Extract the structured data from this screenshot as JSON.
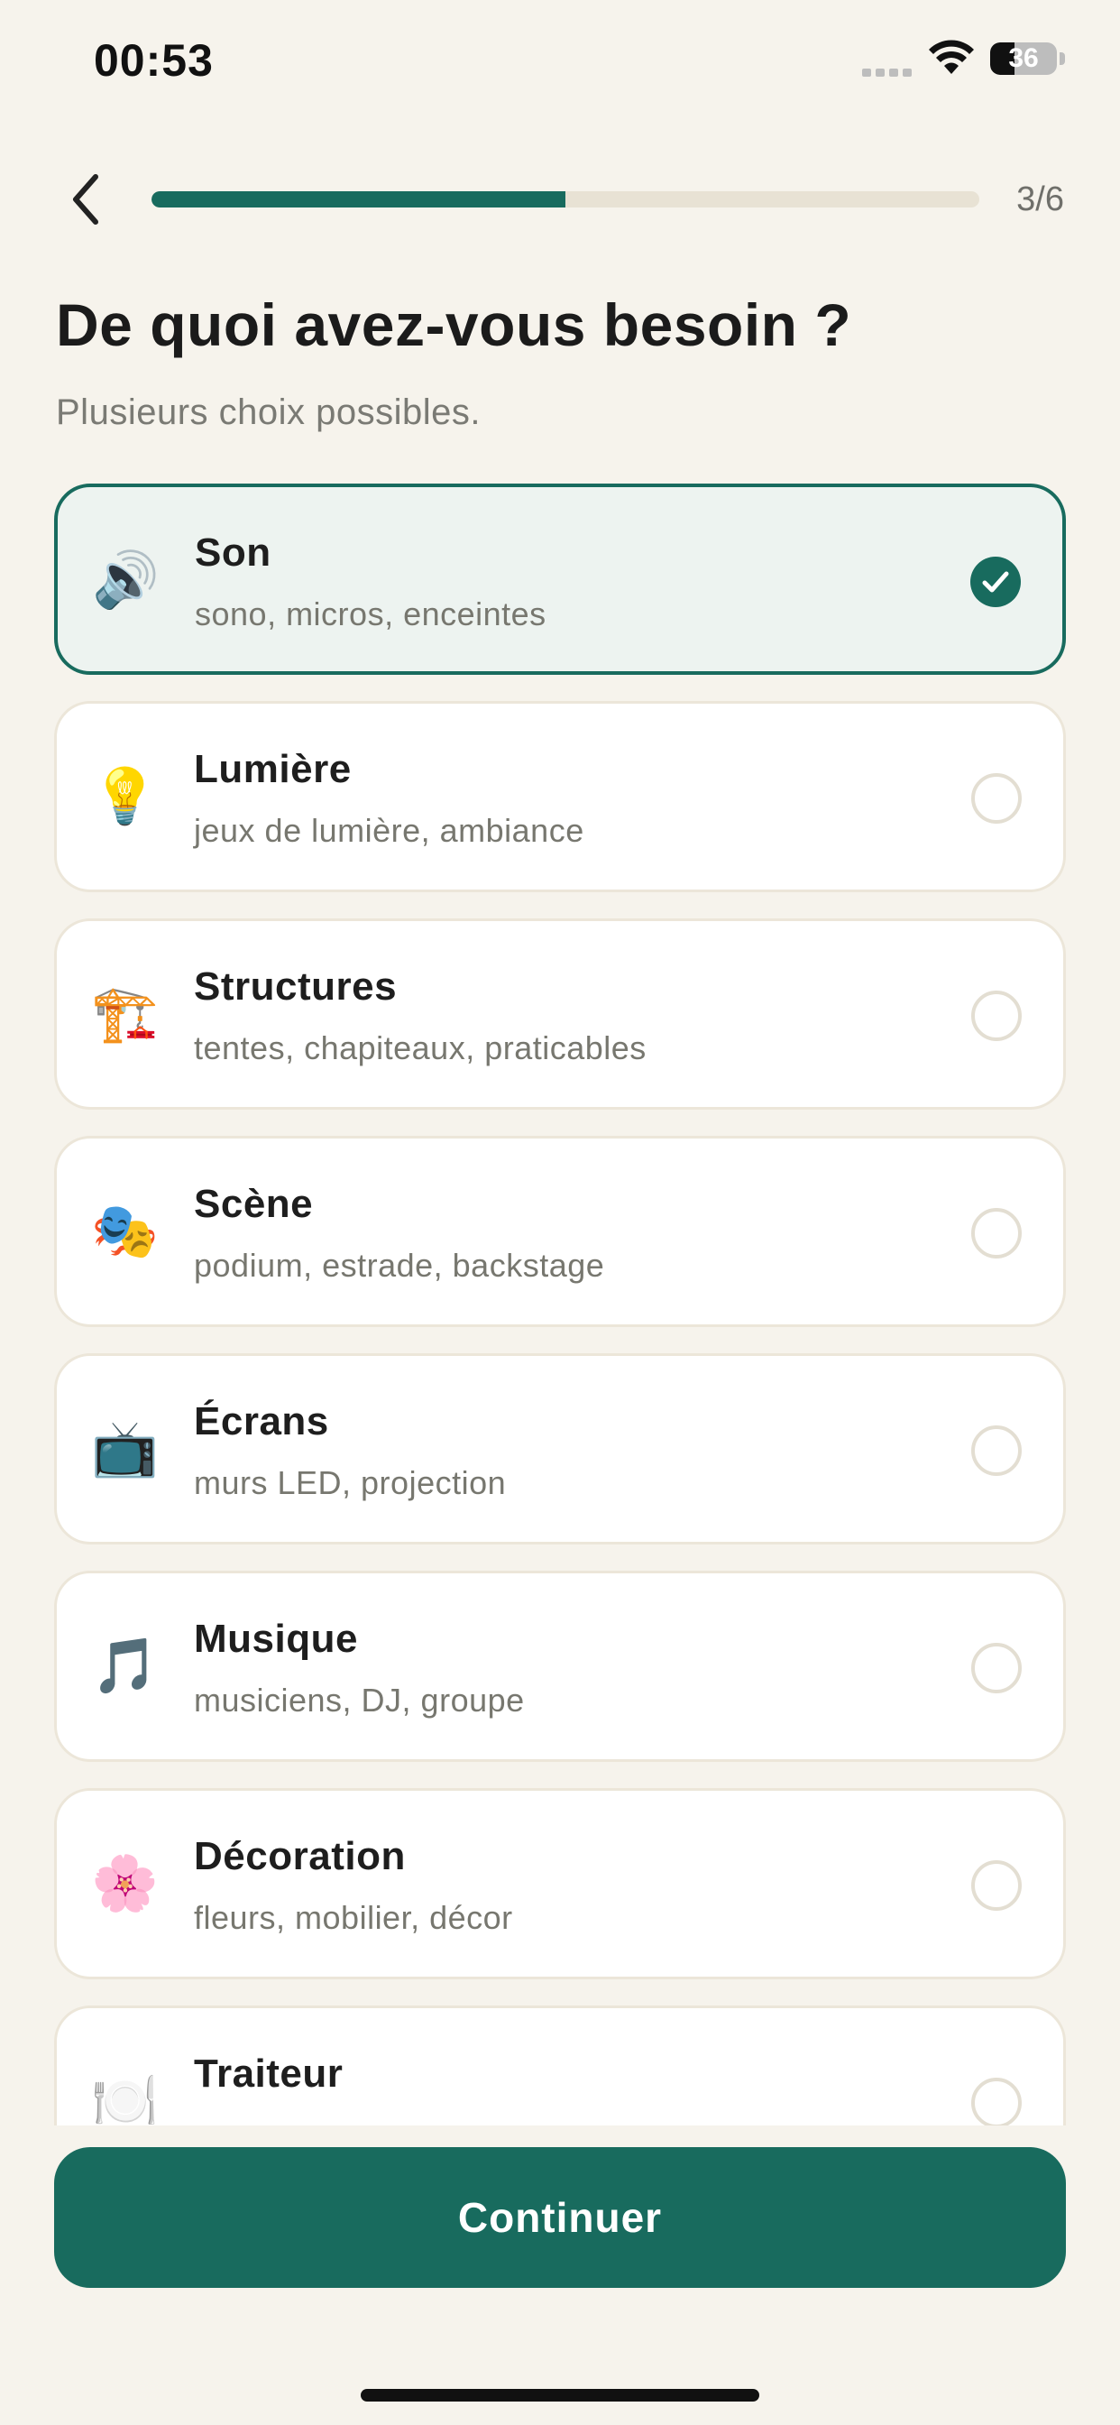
{
  "status_bar": {
    "time": "00:53",
    "battery": "36",
    "battery_level": 0.36
  },
  "header": {
    "step_counter": "3/6",
    "progress": 0.5
  },
  "title": "De quoi avez-vous besoin ?",
  "subtitle": "Plusieurs choix possibles.",
  "options": [
    {
      "emoji": "🔊",
      "icon": "speaker-icon",
      "title": "Son",
      "desc": "sono, micros, enceintes",
      "selected": true
    },
    {
      "emoji": "💡",
      "icon": "light-bulb-icon",
      "title": "Lumière",
      "desc": "jeux de lumière, ambiance",
      "selected": false
    },
    {
      "emoji": "🏗️",
      "icon": "crane-icon",
      "title": "Structures",
      "desc": "tentes, chapiteaux, praticables",
      "selected": false
    },
    {
      "emoji": "🎭",
      "icon": "theater-masks-icon",
      "title": "Scène",
      "desc": "podium, estrade, backstage",
      "selected": false
    },
    {
      "emoji": "📺",
      "icon": "television-icon",
      "title": "Écrans",
      "desc": "murs LED, projection",
      "selected": false
    },
    {
      "emoji": "🎵",
      "icon": "music-note-icon",
      "title": "Musique",
      "desc": "musiciens, DJ, groupe",
      "selected": false
    },
    {
      "emoji": "🌸",
      "icon": "flower-icon",
      "title": "Décoration",
      "desc": "fleurs, mobilier, décor",
      "selected": false
    },
    {
      "emoji": "🍽️",
      "icon": "plate-cutlery-icon",
      "title": "Traiteur",
      "desc": "",
      "selected": false
    }
  ],
  "continue_label": "Continuer",
  "colors": {
    "accent": "#186B5E",
    "background": "#F6F3EC",
    "selected_card": "#EDF3F0",
    "track": "#E8E2D4"
  }
}
